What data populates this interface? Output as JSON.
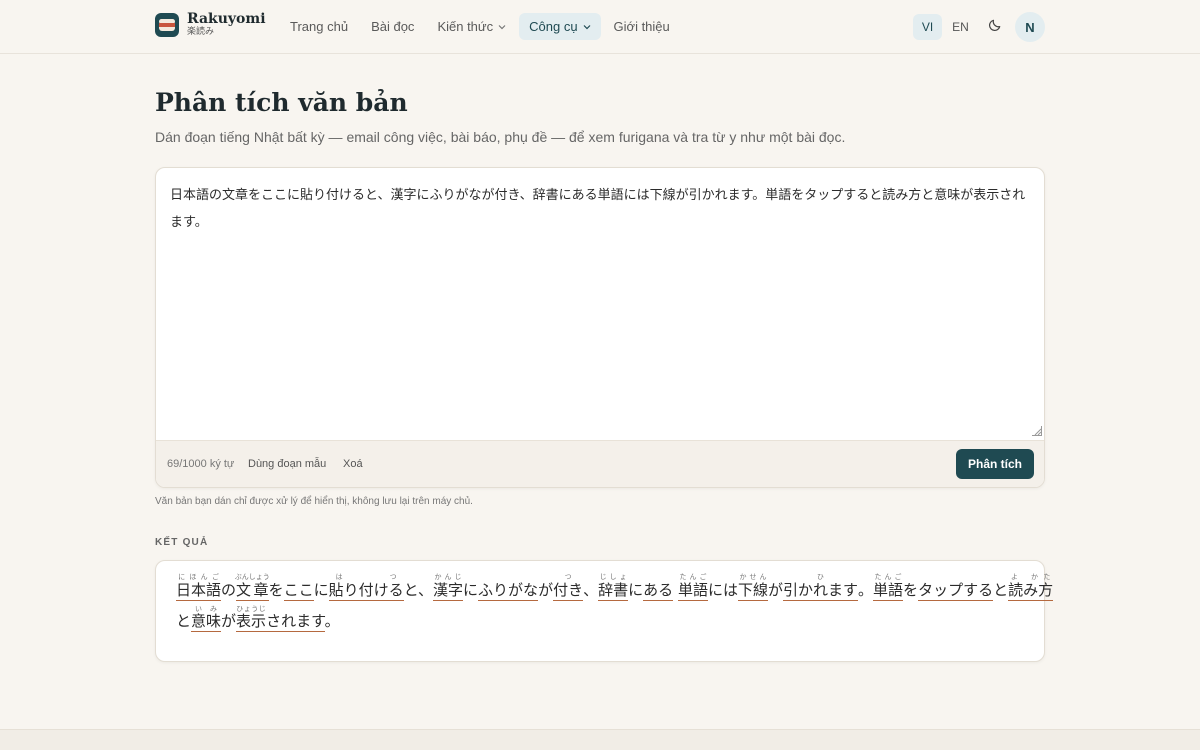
{
  "brand": {
    "name": "Rakuyomi",
    "subtitle": "楽読み"
  },
  "nav": {
    "home": "Trang chủ",
    "reading": "Bài đọc",
    "knowledge": "Kiến thức",
    "tools": "Công cụ",
    "about": "Giới thiệu"
  },
  "controls": {
    "lang_vi": "VI",
    "lang_en": "EN",
    "theme_icon": "moon-icon",
    "avatar_initial": "N"
  },
  "page": {
    "title": "Phân tích văn bản",
    "description": "Dán đoạn tiếng Nhật bất kỳ — email công việc, bài báo, phụ đề — để xem furigana và tra từ y như một bài đọc."
  },
  "editor": {
    "text": "日本語の文章をここに貼り付けると、漢字にふりがなが付き、辞書にある単語には下線が引かれます。単語をタップすると読み方と意味が表示されます。",
    "char_count": "69/1000 ký tự",
    "sample_label": "Dùng đoạn mẫu",
    "clear_label": "Xoá",
    "analyze_label": "Phân tích"
  },
  "privacy_note": "Văn bản bạn dán chỉ được xử lý để hiển thị, không lưu lại trên máy chủ.",
  "result": {
    "heading": "KẾT QUẢ",
    "lines": [
      [
        {
          "t": "日本語",
          "r": "にほんご",
          "w": true
        },
        {
          "t": "の"
        },
        {
          "t": "文章",
          "r": "ぶんしょう",
          "w": true
        },
        {
          "t": "を"
        },
        {
          "t": "ここ",
          "w": true
        },
        {
          "t": "に"
        },
        {
          "t": "貼り付ける",
          "r": "は つ",
          "w": true
        },
        {
          "t": "と、"
        },
        {
          "t": "漢字",
          "r": "かんじ",
          "w": true
        },
        {
          "t": "に"
        },
        {
          "t": "ふりがな",
          "w": true
        },
        {
          "t": "が"
        },
        {
          "t": "付き",
          "r": "つ",
          "w": true
        },
        {
          "t": "、"
        },
        {
          "t": "辞書",
          "r": "じしょ",
          "w": true
        },
        {
          "t": "に"
        },
        {
          "t": "ある",
          "w": true
        },
        {
          "t": " "
        },
        {
          "t": "単語",
          "r": "たんご",
          "w": true
        },
        {
          "t": "には"
        },
        {
          "t": "下線",
          "r": "かせん",
          "w": true
        },
        {
          "t": "が"
        },
        {
          "t": "引かれます",
          "r": "ひ",
          "w": true
        },
        {
          "t": "。"
        },
        {
          "t": "単語",
          "r": "たんご",
          "w": true
        },
        {
          "t": "を"
        },
        {
          "t": "タップ",
          "w": true
        },
        {
          "t": "する",
          "w": true
        },
        {
          "t": "と"
        },
        {
          "t": "読み方",
          "r": "よ かた",
          "w": true
        }
      ],
      [
        {
          "t": "と"
        },
        {
          "t": "意味",
          "r": "いみ",
          "w": true
        },
        {
          "t": "が"
        },
        {
          "t": "表示",
          "r": "ひょうじ",
          "w": true
        },
        {
          "t": "されます",
          "w": true
        },
        {
          "t": "。"
        }
      ]
    ]
  }
}
